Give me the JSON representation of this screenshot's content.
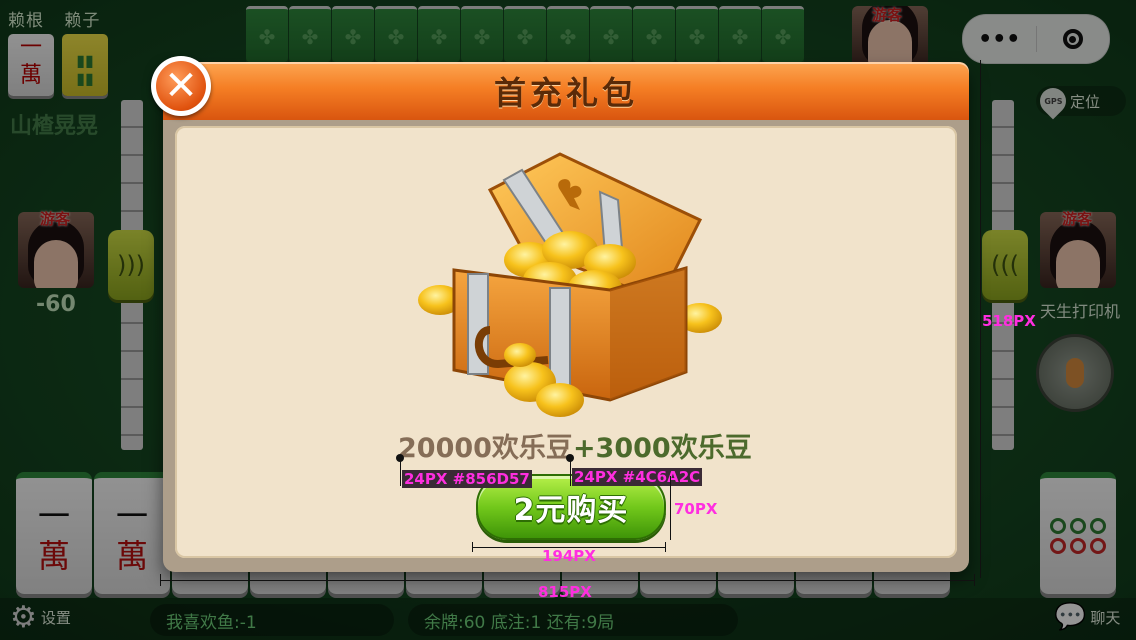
{
  "game": {
    "labels": [
      "赖根",
      "赖子"
    ],
    "laigen_tile": "一\n萬",
    "guest_label": "游客",
    "left_player": {
      "tag": "游客",
      "score": "-60"
    },
    "right_player": {
      "tag": "游客",
      "name": "天生打印机"
    },
    "top_player": {
      "tag": "游客"
    },
    "gps": {
      "pin": "GPS",
      "label": "定位"
    },
    "watermark": "山楂晃晃",
    "hand_tiles": [
      {
        "top": "一",
        "bottom": "萬"
      },
      {
        "top": "一",
        "bottom": "萬"
      }
    ],
    "bottom": {
      "settings": "设置",
      "player_info": "我喜欢鱼:-1",
      "status": "余牌:60  底注:1  还有:9局",
      "chat": "聊天"
    }
  },
  "mini_program": {
    "more_label": "•••"
  },
  "modal": {
    "title": "首充礼包",
    "close_label": "✕",
    "offer_base": "20000欢乐豆",
    "offer_bonus": "+3000欢乐豆",
    "buy_label": "2元购买",
    "colors": {
      "header": "#f57e24",
      "panel": "#f1e3cb",
      "offer_base": "#856d57",
      "offer_bonus": "#4c6a2c",
      "buy_button": "#72c81b"
    }
  },
  "annotations": {
    "base_text": "24PX #856D57",
    "bonus_text": "24PX #4C6A2C",
    "button_height": "70PX",
    "button_width": "194PX",
    "panel_width": "815PX",
    "panel_height": "518PX"
  }
}
